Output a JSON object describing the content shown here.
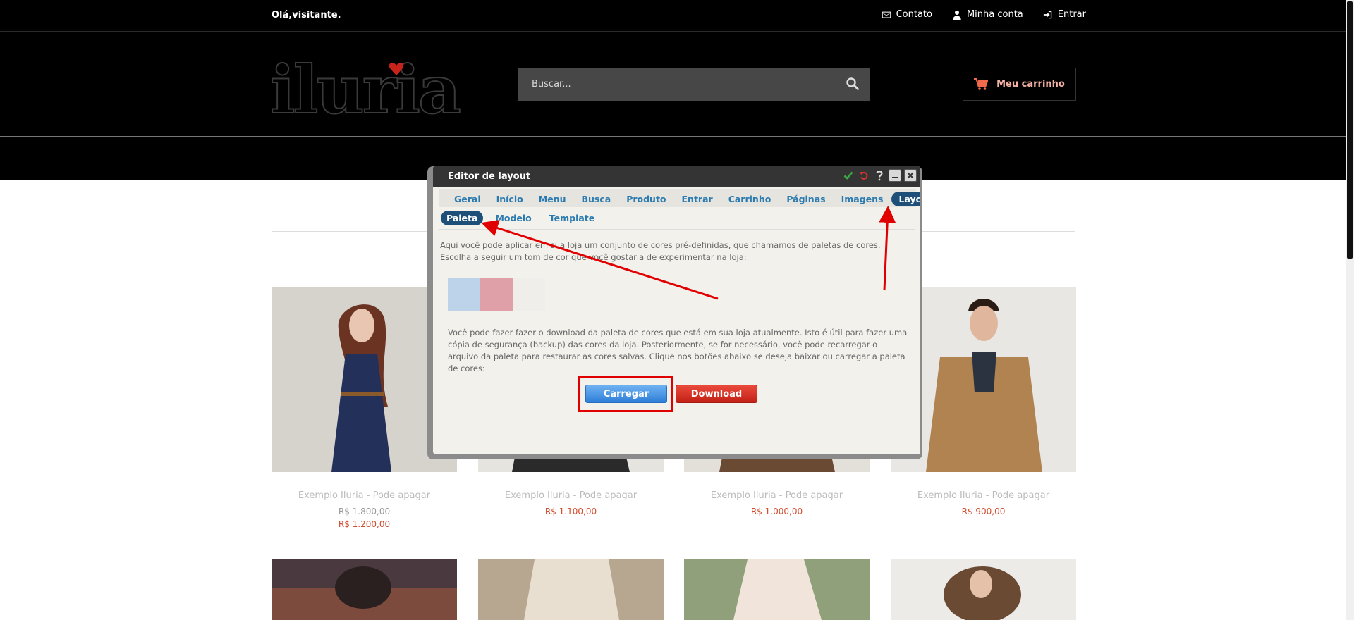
{
  "topbar": {
    "greeting": "Olá,visitante.",
    "links": [
      {
        "label": "Contato",
        "icon": "envelope-icon"
      },
      {
        "label": "Minha conta",
        "icon": "user-icon"
      },
      {
        "label": "Entrar",
        "icon": "sign-in-icon"
      }
    ]
  },
  "header": {
    "logo_text": "iluria",
    "search_placeholder": "Buscar...",
    "cart_label": "Meu carrinho"
  },
  "products": [
    {
      "name": "Exemplo Iluria - Pode apagar",
      "old_price": "R$ 1.800,00",
      "price": "R$ 1.200,00"
    },
    {
      "name": "Exemplo Iluria - Pode apagar",
      "price": "R$ 1.100,00"
    },
    {
      "name": "Exemplo Iluria - Pode apagar",
      "price": "R$ 1.000,00"
    },
    {
      "name": "Exemplo Iluria - Pode apagar",
      "price": "R$ 900,00"
    }
  ],
  "editor": {
    "title": "Editor de layout",
    "tabs": [
      "Geral",
      "Início",
      "Menu",
      "Busca",
      "Produto",
      "Entrar",
      "Carrinho",
      "Páginas",
      "Imagens",
      "Layout"
    ],
    "active_tab": "Layout",
    "subtabs": [
      "Paleta",
      "Modelo",
      "Template"
    ],
    "active_subtab": "Paleta",
    "intro_text": "Aqui você pode aplicar em sua loja um conjunto de cores pré-definidas, que chamamos de paletas de cores. Escolha a seguir um tom de cor que você gostaria de experimentar na loja:",
    "swatches": [
      "#bcd3e9",
      "#e0a0a8",
      "#efeeea"
    ],
    "download_text": "Você pode fazer fazer o download da paleta de cores que está em sua loja atualmente. Isto é útil para fazer uma cópia de segurança (backup) das cores da loja. Posteriormente, se for necessário, você pode recarregar o arquivo da paleta para restaurar as cores salvas. Clique nos botões abaixo se deseja baixar ou carregar a paleta de cores:",
    "load_button": "Carregar",
    "download_button": "Download"
  },
  "colors": {
    "price_red": "#d24b2c",
    "tab_blue": "#2b7bb0",
    "tab_active": "#1d4f79",
    "annotation_red": "#e00000"
  }
}
